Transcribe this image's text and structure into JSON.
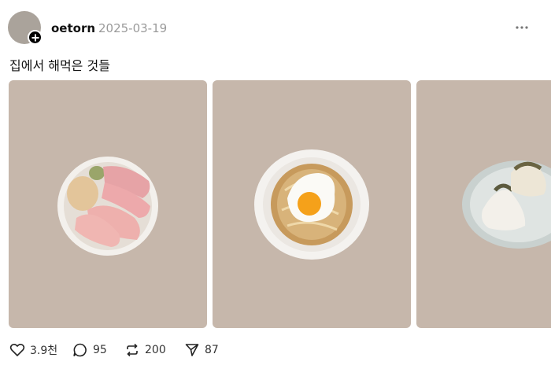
{
  "post": {
    "username": "oetorn",
    "date": "2025-03-19",
    "text": "집에서 해먹은 것들"
  },
  "photos": [
    {
      "name": "photo-yellowtail-bowl"
    },
    {
      "name": "photo-fried-egg-noodles"
    },
    {
      "name": "photo-onigiri"
    }
  ],
  "actions": {
    "likes": "3.9천",
    "comments": "95",
    "reposts": "200",
    "shares": "87"
  },
  "colors": {
    "photo_background": "#c6b7ab",
    "date_text": "#9a9a9a"
  }
}
